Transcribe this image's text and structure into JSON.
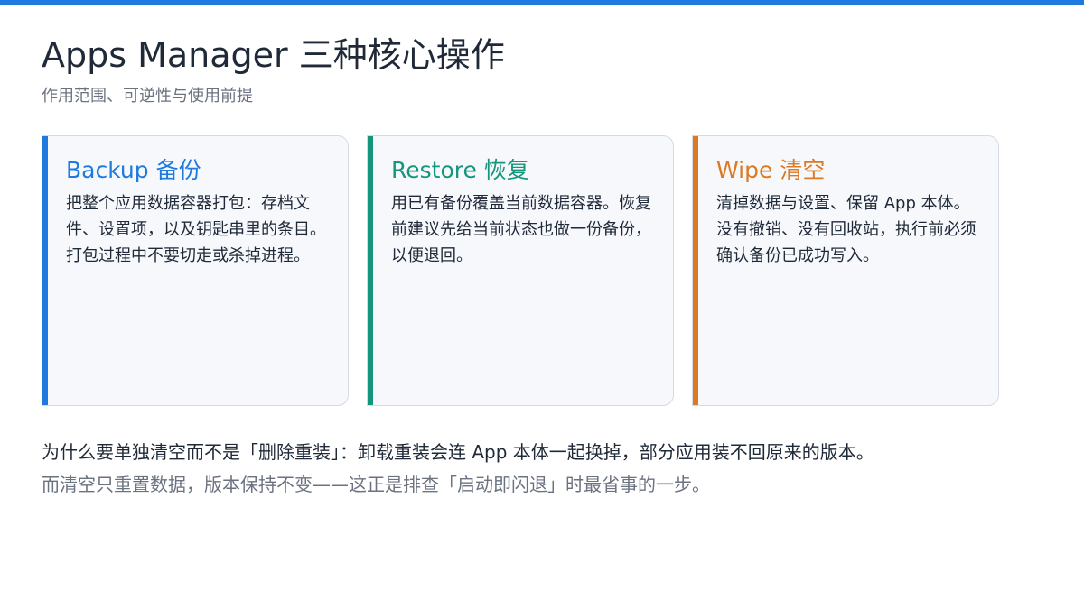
{
  "header": {
    "title": "Apps Manager 三种核心操作",
    "subtitle": "作用范围、可逆性与使用前提"
  },
  "colors": {
    "top_bar": "#1f7ae0",
    "backup": "#1f7ae0",
    "restore": "#14967d",
    "wipe": "#dc7a23"
  },
  "cards": [
    {
      "title": "Backup 备份",
      "body": "把整个应用数据容器打包：存档文件、设置项，以及钥匙串里的条目。打包过程中不要切走或杀掉进程。"
    },
    {
      "title": "Restore 恢复",
      "body": "用已有备份覆盖当前数据容器。恢复前建议先给当前状态也做一份备份，以便退回。"
    },
    {
      "title": "Wipe 清空",
      "body": "清掉数据与设置、保留 App 本体。没有撤销、没有回收站，执行前必须确认备份已成功写入。"
    }
  ],
  "footer": {
    "line1": "为什么要单独清空而不是「删除重装」：卸载重装会连 App 本体一起换掉，部分应用装不回原来的版本。",
    "line2": "而清空只重置数据，版本保持不变——这正是排查「启动即闪退」时最省事的一步。"
  }
}
